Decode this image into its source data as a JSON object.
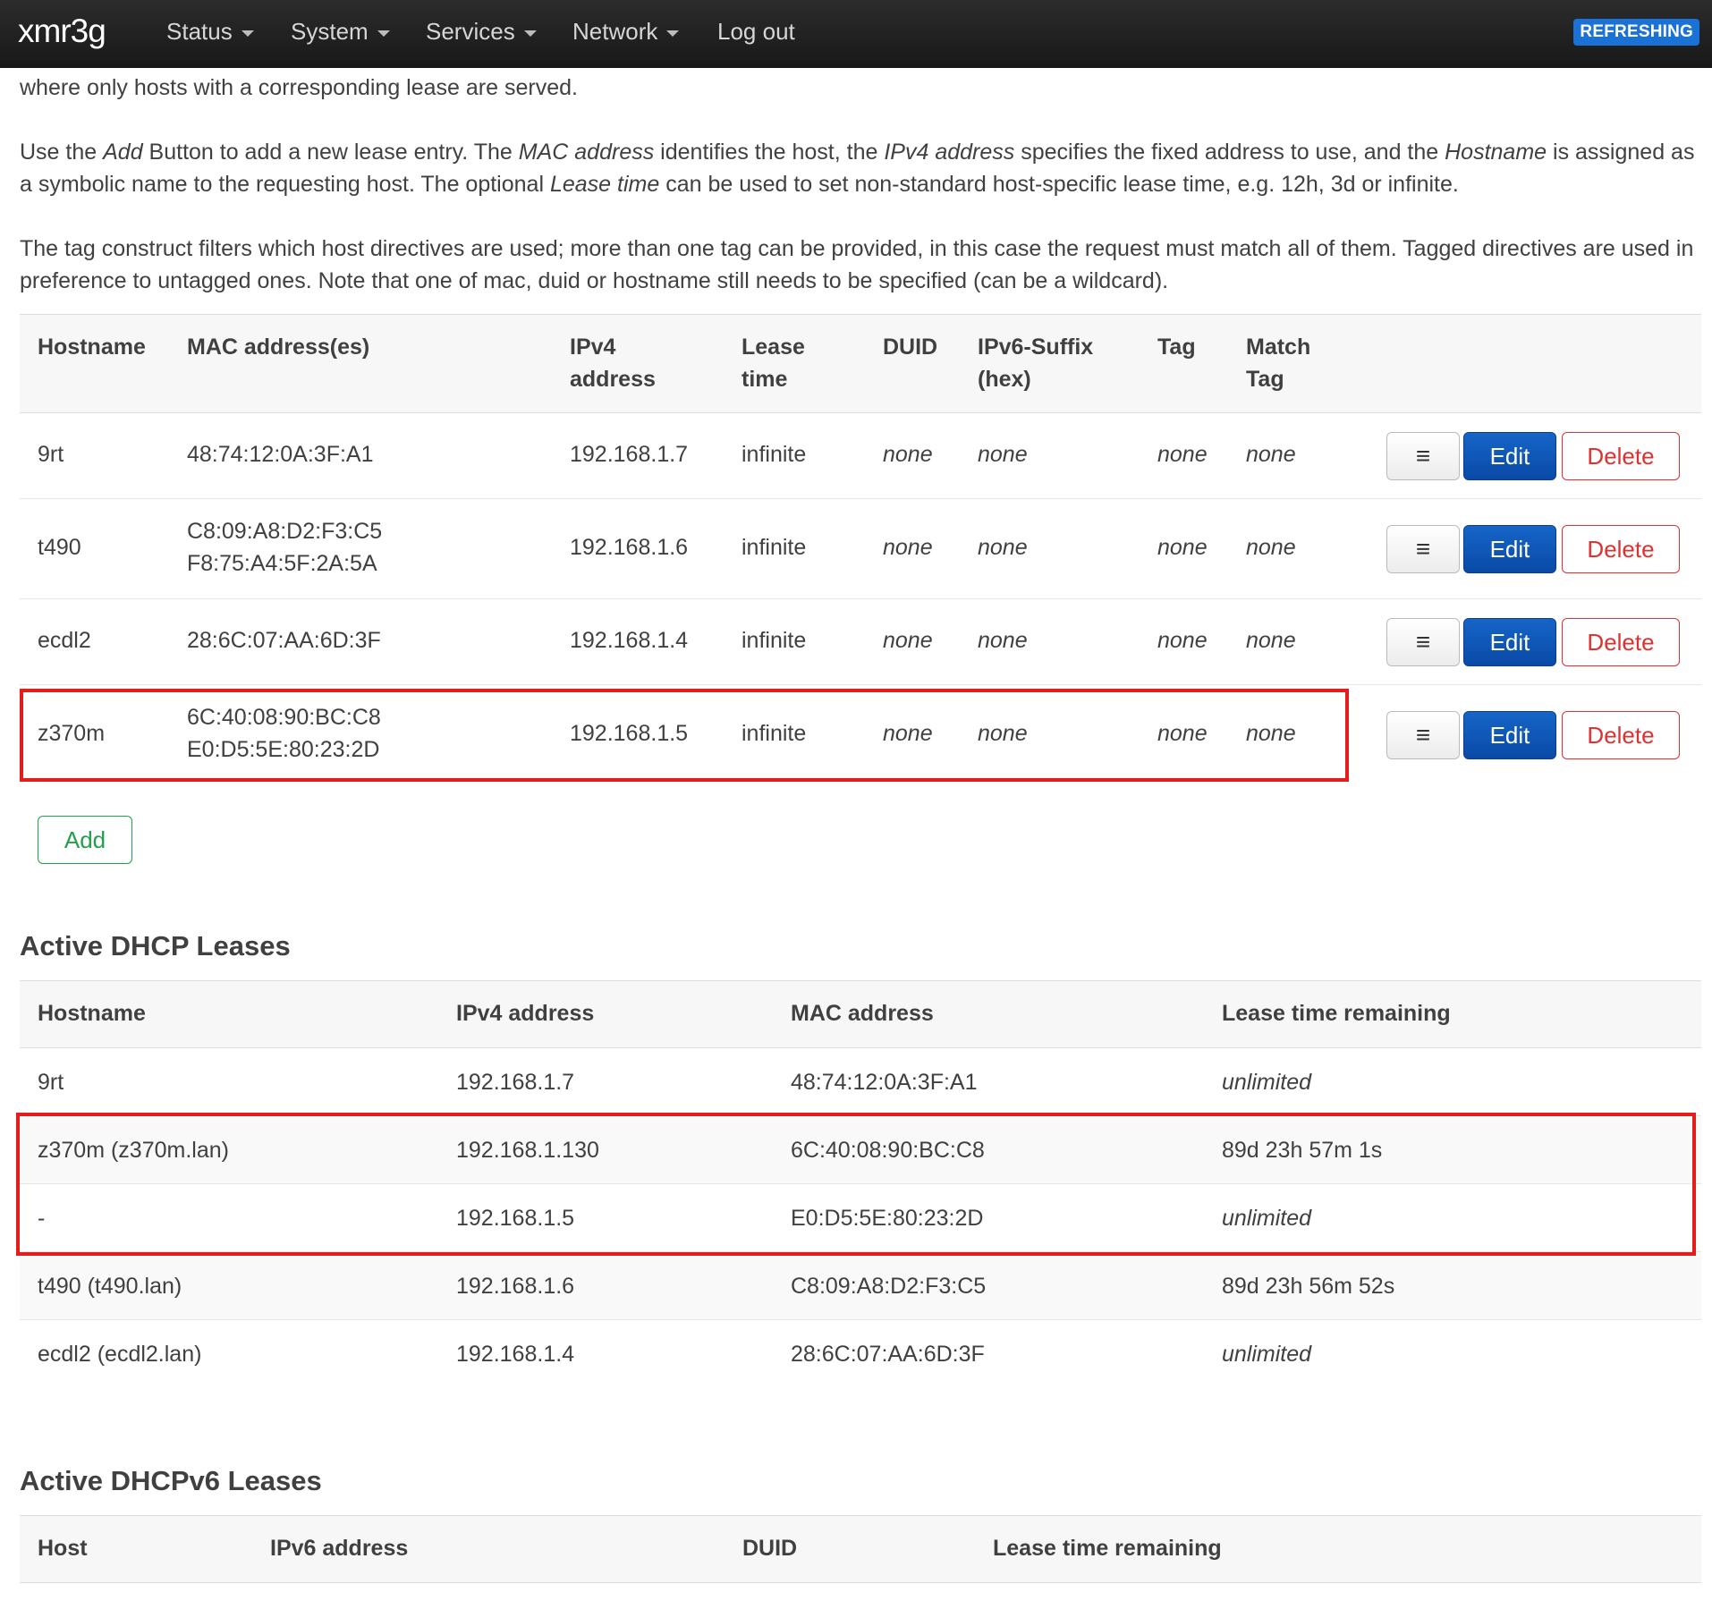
{
  "navbar": {
    "brand": "xmr3g",
    "menus": [
      {
        "label": "Status"
      },
      {
        "label": "System"
      },
      {
        "label": "Services"
      },
      {
        "label": "Network"
      }
    ],
    "logout": "Log out",
    "badge": "REFRESHING"
  },
  "intro": {
    "p1": "where only hosts with a corresponding lease are served.",
    "p2": [
      {
        "t": "Use the "
      },
      {
        "t": "Add",
        "i": true
      },
      {
        "t": " Button to add a new lease entry. The "
      },
      {
        "t": "MAC address",
        "i": true
      },
      {
        "t": " identifies the host, the "
      },
      {
        "t": "IPv4 address",
        "i": true
      },
      {
        "t": " specifies the fixed address to use, and the "
      },
      {
        "t": "Hostname",
        "i": true
      },
      {
        "t": " is assigned as a symbolic name to the requesting host. The optional "
      },
      {
        "t": "Lease time",
        "i": true
      },
      {
        "t": " can be used to set non-standard host-specific lease time, e.g. 12h, 3d or infinite."
      }
    ],
    "p3": "The tag construct filters which host directives are used; more than one tag can be provided, in this case the request must match all of them. Tagged directives are used in preference to untagged ones. Note that one of mac, duid or hostname still needs to be specified (can be a wildcard)."
  },
  "static_leases": {
    "headers": {
      "hostname": "Hostname",
      "mac": "MAC address(es)",
      "ipv4_1": "IPv4",
      "ipv4_2": "address",
      "lease_1": "Lease",
      "lease_2": "time",
      "duid": "DUID",
      "ipv6_1": "IPv6-Suffix",
      "ipv6_2": "(hex)",
      "tag": "Tag",
      "match_1": "Match",
      "match_2": "Tag"
    },
    "rows": [
      {
        "hostname": "9rt",
        "mac1": "48:74:12:0A:3F:A1",
        "mac2": "",
        "ipv4": "192.168.1.7",
        "lease": "infinite",
        "duid": "none",
        "ipv6": "none",
        "tag": "none",
        "match": "none"
      },
      {
        "hostname": "t490",
        "mac1": "C8:09:A8:D2:F3:C5",
        "mac2": "F8:75:A4:5F:2A:5A",
        "ipv4": "192.168.1.6",
        "lease": "infinite",
        "duid": "none",
        "ipv6": "none",
        "tag": "none",
        "match": "none"
      },
      {
        "hostname": "ecdl2",
        "mac1": "28:6C:07:AA:6D:3F",
        "mac2": "",
        "ipv4": "192.168.1.4",
        "lease": "infinite",
        "duid": "none",
        "ipv6": "none",
        "tag": "none",
        "match": "none"
      },
      {
        "hostname": "z370m",
        "mac1": "6C:40:08:90:BC:C8",
        "mac2": "E0:D5:5E:80:23:2D",
        "ipv4": "192.168.1.5",
        "lease": "infinite",
        "duid": "none",
        "ipv6": "none",
        "tag": "none",
        "match": "none"
      }
    ],
    "buttons": {
      "menu": "≡",
      "edit": "Edit",
      "delete": "Delete"
    },
    "add": "Add"
  },
  "dhcp_leases": {
    "title": "Active DHCP Leases",
    "headers": {
      "hostname": "Hostname",
      "ipv4": "IPv4 address",
      "mac": "MAC address",
      "remaining": "Lease time remaining"
    },
    "rows": [
      {
        "hostname": "9rt",
        "ipv4": "192.168.1.7",
        "mac": "48:74:12:0A:3F:A1",
        "remaining": "unlimited",
        "italic": true
      },
      {
        "hostname": "z370m (z370m.lan)",
        "ipv4": "192.168.1.130",
        "mac": "6C:40:08:90:BC:C8",
        "remaining": "89d 23h 57m 1s",
        "italic": false
      },
      {
        "hostname": "-",
        "ipv4": "192.168.1.5",
        "mac": "E0:D5:5E:80:23:2D",
        "remaining": "unlimited",
        "italic": true
      },
      {
        "hostname": "t490 (t490.lan)",
        "ipv4": "192.168.1.6",
        "mac": "C8:09:A8:D2:F3:C5",
        "remaining": "89d 23h 56m 52s",
        "italic": false
      },
      {
        "hostname": "ecdl2 (ecdl2.lan)",
        "ipv4": "192.168.1.4",
        "mac": "28:6C:07:AA:6D:3F",
        "remaining": "unlimited",
        "italic": true
      }
    ]
  },
  "dhcpv6_leases": {
    "title": "Active DHCPv6 Leases",
    "headers": {
      "host": "Host",
      "ipv6": "IPv6 address",
      "duid": "DUID",
      "remaining": "Lease time remaining"
    }
  },
  "colors": {
    "highlight": "#e41c1c",
    "edit": "#0a4aa7",
    "delete": "#e03030",
    "add": "#22a04b",
    "badge": "#1a72d6"
  }
}
